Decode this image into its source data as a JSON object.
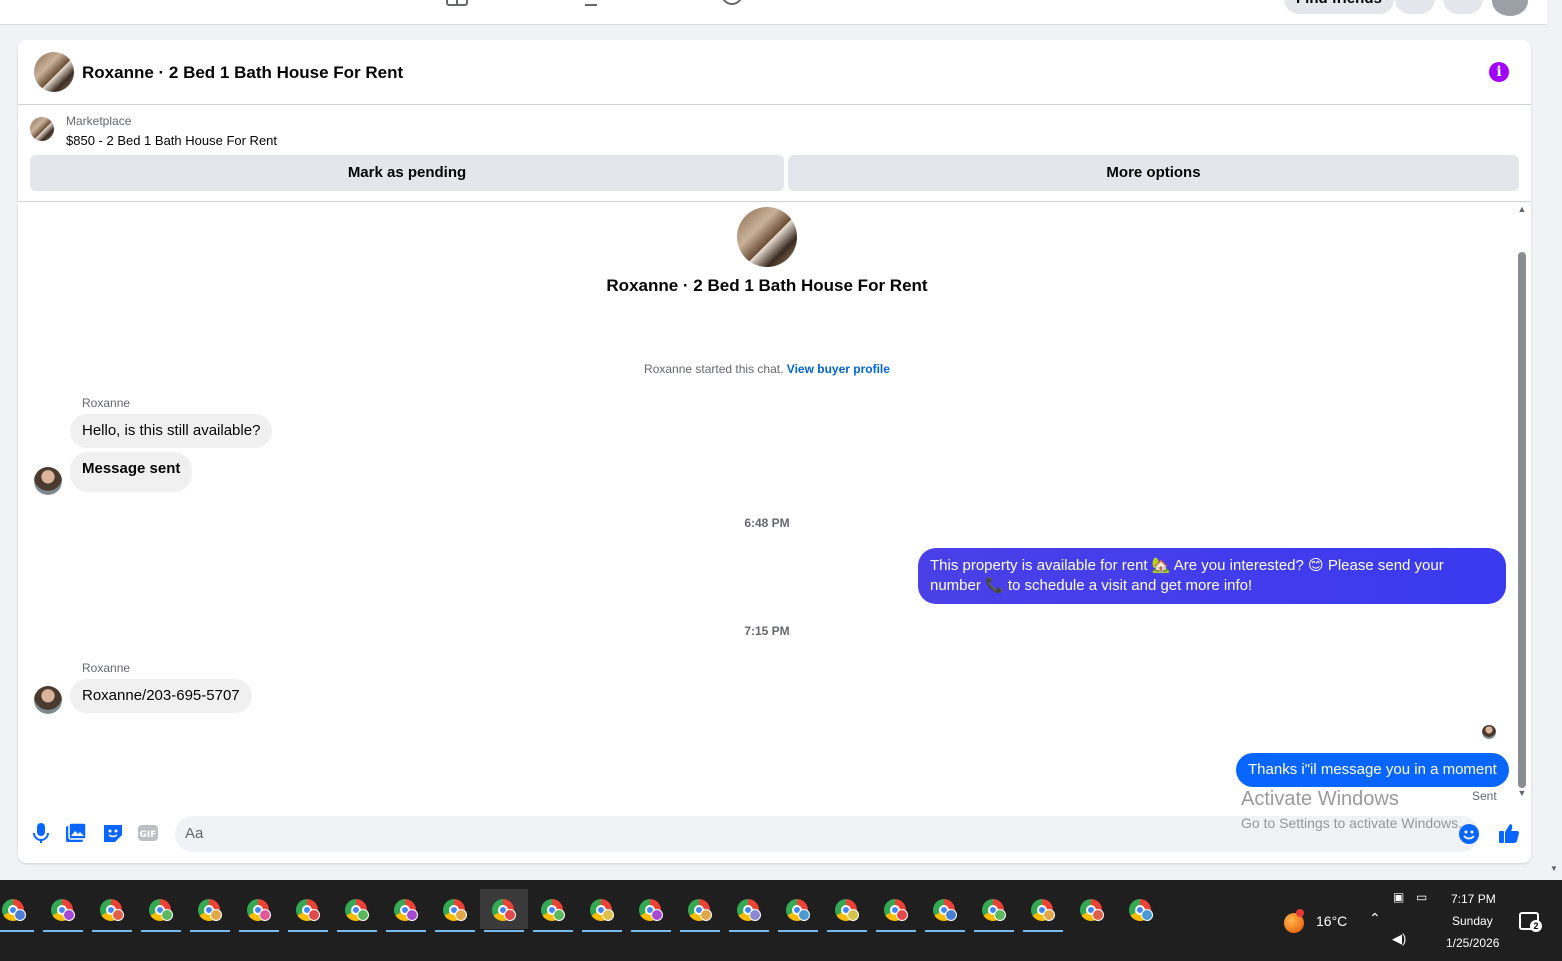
{
  "top": {
    "find_friends": "Find friends"
  },
  "chat": {
    "title": "Roxanne · 2 Bed 1 Bath House For Rent",
    "marketplace_label": "Marketplace",
    "listing": "$850 - 2 Bed 1 Bath House For Rent",
    "mark_pending": "Mark as pending",
    "more_options": "More options",
    "center_title": "Roxanne · 2 Bed 1 Bath House For Rent",
    "started_text": "Roxanne started this chat.",
    "view_profile": "View buyer profile",
    "messages": [
      {
        "sender": "Roxanne",
        "text": "Hello, is this still available?"
      },
      {
        "text": "Message sent"
      },
      {
        "time": "6:48 PM"
      },
      {
        "text": "This property is available for rent 🏡 Are you interested? 😊 Please send your number 📞 to schedule a visit and get more info!"
      },
      {
        "time": "7:15 PM"
      },
      {
        "sender": "Roxanne",
        "text": "Roxanne/203-695-5707"
      },
      {
        "text": "Thanks i\"il message you in a moment"
      }
    ],
    "sent_status": "Sent",
    "input_placeholder": "Aa"
  },
  "watermark": {
    "line1": "Activate Windows",
    "line2": "Go to Settings to activate Windows."
  },
  "taskbar": {
    "app_count": 24,
    "badge_colors": [
      "#4a7fd4",
      "#a64ad4",
      "#e0604a",
      "#5cb85c",
      "#e0a84a",
      "#e05a9a",
      "#e04a4a",
      "#5cb85c",
      "#a64ad4",
      "#e0a84a",
      "#e04a4a",
      "#5cb85c",
      "#e0c04a",
      "#a64ad4",
      "#e0a84a",
      "#8a8ad4",
      "#4a9ad4",
      "#d4c44a",
      "#e04a4a",
      "#4a7fd4",
      "#5cb85c",
      "#e0a84a",
      "#e0604a",
      "#4a9ad4"
    ],
    "weather": "16°C",
    "weather_badge": "1",
    "time": "7:17 PM",
    "day": "Sunday",
    "date": "1/25/2026",
    "notifications": "2"
  },
  "colors": {
    "accent": "#0866ff",
    "info": "#a100ff",
    "out_bubble": "#4a40e8"
  }
}
